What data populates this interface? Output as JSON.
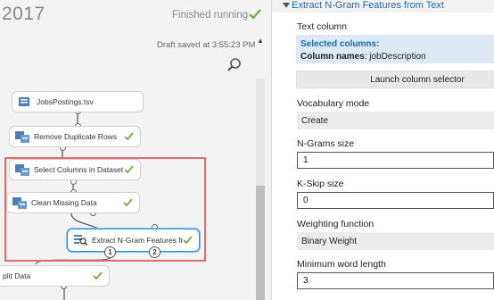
{
  "canvas": {
    "experiment_title_fragment": "2017",
    "status_text": "Finished running",
    "draft_saved": "Draft saved at 3:55:23 PM",
    "nodes": {
      "dataset": {
        "label": "JobsPostings.tsv"
      },
      "remove_duplicates": {
        "label": "Remove Duplicate Rows"
      },
      "select_columns": {
        "label": "Select Columns in Dataset"
      },
      "clean_missing": {
        "label": "Clean Missing Data"
      },
      "extract_ngram": {
        "label": "Extract N-Gram Features fro..."
      },
      "split_data": {
        "label": "plit Data"
      }
    },
    "ports": {
      "port_1": "1",
      "port_2": "2"
    },
    "colors": {
      "status_check": "#6cb33f",
      "highlight": "#e46a6a",
      "selected": "#2a8fd8"
    }
  },
  "pane": {
    "title": "Extract N-Gram Features from Text",
    "text_column": {
      "label": "Text column",
      "selected_heading": "Selected columns:",
      "column_names_label": "Column names",
      "column_names_value": ": jobDescription",
      "launch_button": "Launch column selector"
    },
    "vocabulary_mode": {
      "label": "Vocabulary mode",
      "value": "Create"
    },
    "ngrams_size": {
      "label": "N-Grams size",
      "value": "1"
    },
    "kskip_size": {
      "label": "K-Skip size",
      "value": "0"
    },
    "weighting_function": {
      "label": "Weighting function",
      "value": "Binary Weight"
    },
    "min_word_length": {
      "label": "Minimum word length",
      "value": "3"
    }
  }
}
